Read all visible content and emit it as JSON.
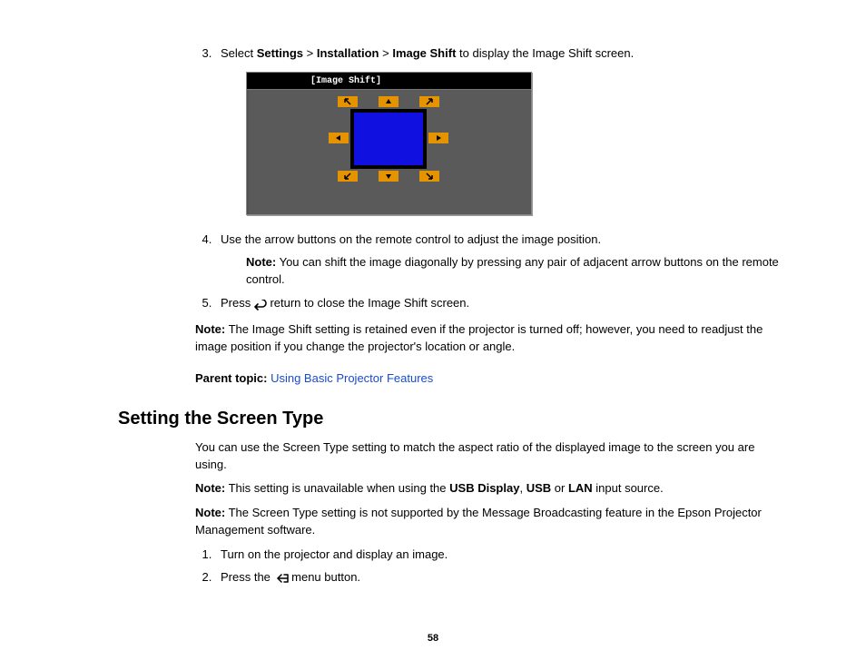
{
  "step3": {
    "number": "3.",
    "prefix": "Select ",
    "bold1": "Settings",
    "sep1": " > ",
    "bold2": "Installation",
    "sep2": " > ",
    "bold3": "Image Shift",
    "suffix": " to display the Image Shift screen."
  },
  "diagram": {
    "title": "[Image Shift]"
  },
  "step4": {
    "number": "4.",
    "text": "Use the arrow buttons on the remote control to adjust the image position.",
    "note_label": "Note:",
    "note_text": " You can shift the image diagonally by pressing any pair of adjacent arrow buttons on the remote control."
  },
  "step5": {
    "number": "5.",
    "prefix": "Press ",
    "suffix": " return to close the Image Shift screen."
  },
  "note_retain": {
    "label": "Note:",
    "text": " The Image Shift setting is retained even if the projector is turned off; however, you need to readjust the image position if you change the projector's location or angle."
  },
  "parent_topic": {
    "label": "Parent topic:",
    "link": " Using Basic Projector Features"
  },
  "heading": "Setting the Screen Type",
  "intro": "You can use the Screen Type setting to match the aspect ratio of the displayed image to the screen you are using.",
  "note_unavail": {
    "label": "Note:",
    "prefix": " This setting is unavailable when using the ",
    "bold1": "USB Display",
    "sep1": ", ",
    "bold2": "USB",
    "sep2": " or ",
    "bold3": "LAN",
    "suffix": " input source."
  },
  "note_broadcast": {
    "label": "Note:",
    "text": " The Screen Type setting is not supported by the Message Broadcasting feature in the Epson Projector Management software."
  },
  "steps_bottom": {
    "s1_num": "1.",
    "s1_text": "Turn on the projector and display an image.",
    "s2_num": "2.",
    "s2_prefix": "Press the ",
    "s2_suffix": " menu button."
  },
  "page_number": "58"
}
